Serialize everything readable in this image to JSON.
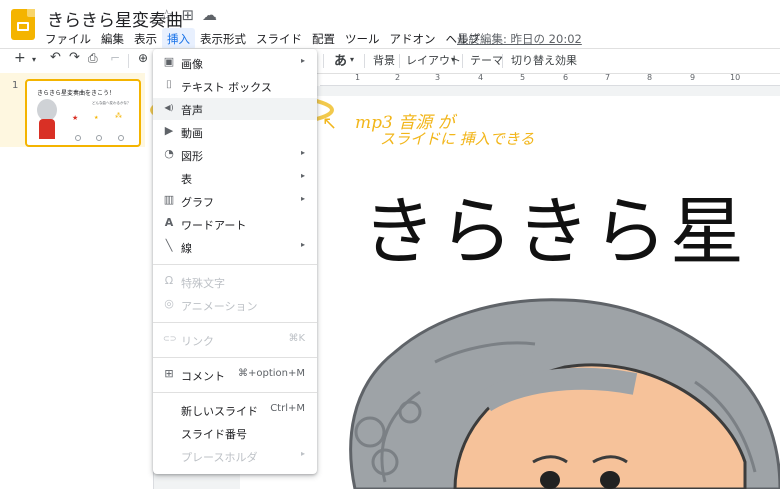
{
  "app": {
    "title": "きらきら星変奏曲",
    "title_icons": [
      "☆",
      "⊞",
      "☁"
    ],
    "last_edit": "最終編集: 昨日の 20:02",
    "accent_color": "#f4b400"
  },
  "menubar": [
    "ファイル",
    "編集",
    "表示",
    "挿入",
    "表示形式",
    "スライド",
    "配置",
    "ツール",
    "アドオン",
    "ヘルプ"
  ],
  "toolbar": {
    "font_button": "あ",
    "background": "背景",
    "layout": "レイアウト",
    "theme": "テーマ",
    "transition": "切り替え効果"
  },
  "ruler_numbers": [
    "1",
    "2",
    "3",
    "4",
    "5",
    "6",
    "7",
    "8",
    "9",
    "10"
  ],
  "filmstrip": {
    "slide_number": "1",
    "thumb_title": "きらきら星変奏曲をきこう！",
    "thumb_sub": "どんな曲へ変わるかな？"
  },
  "slide": {
    "title": "きらきら星"
  },
  "insert_menu": {
    "items": [
      {
        "label": "画像",
        "icon": "image-icon",
        "glyph": "▣",
        "arrow": "▸"
      },
      {
        "label": "テキスト ボックス",
        "icon": "textbox-icon",
        "glyph": "⌷"
      },
      {
        "label": "音声",
        "icon": "audio-icon",
        "glyph": "◀)"
      },
      {
        "label": "動画",
        "icon": "video-icon",
        "glyph": "▶"
      },
      {
        "label": "図形",
        "icon": "shape-icon",
        "glyph": "◔",
        "arrow": "▸"
      },
      {
        "label": "表",
        "icon": "",
        "glyph": "",
        "arrow": "▸"
      },
      {
        "label": "グラフ",
        "icon": "chart-icon",
        "glyph": "▥",
        "arrow": "▸"
      },
      {
        "label": "ワードアート",
        "icon": "wordart-icon",
        "glyph": "A"
      },
      {
        "label": "線",
        "icon": "line-icon",
        "glyph": "╲",
        "arrow": "▸"
      },
      {
        "label": "特殊文字",
        "icon": "omega-icon",
        "glyph": "Ω"
      },
      {
        "label": "アニメーション",
        "icon": "animation-icon",
        "glyph": "◎"
      },
      {
        "label": "リンク",
        "icon": "link-icon",
        "glyph": "⊂⊃",
        "shortcut": "⌘K"
      },
      {
        "label": "コメント",
        "icon": "comment-icon",
        "glyph": "⊞",
        "shortcut": "⌘+option+M"
      },
      {
        "label": "新しいスライド",
        "shortcut": "Ctrl+M"
      },
      {
        "label": "スライド番号"
      },
      {
        "label": "プレースホルダ",
        "arrow": "▸"
      }
    ]
  },
  "annotation": {
    "line1": "mp3 音源 が",
    "line2": "スライドに 挿入できる",
    "color": "#f2b61b"
  }
}
